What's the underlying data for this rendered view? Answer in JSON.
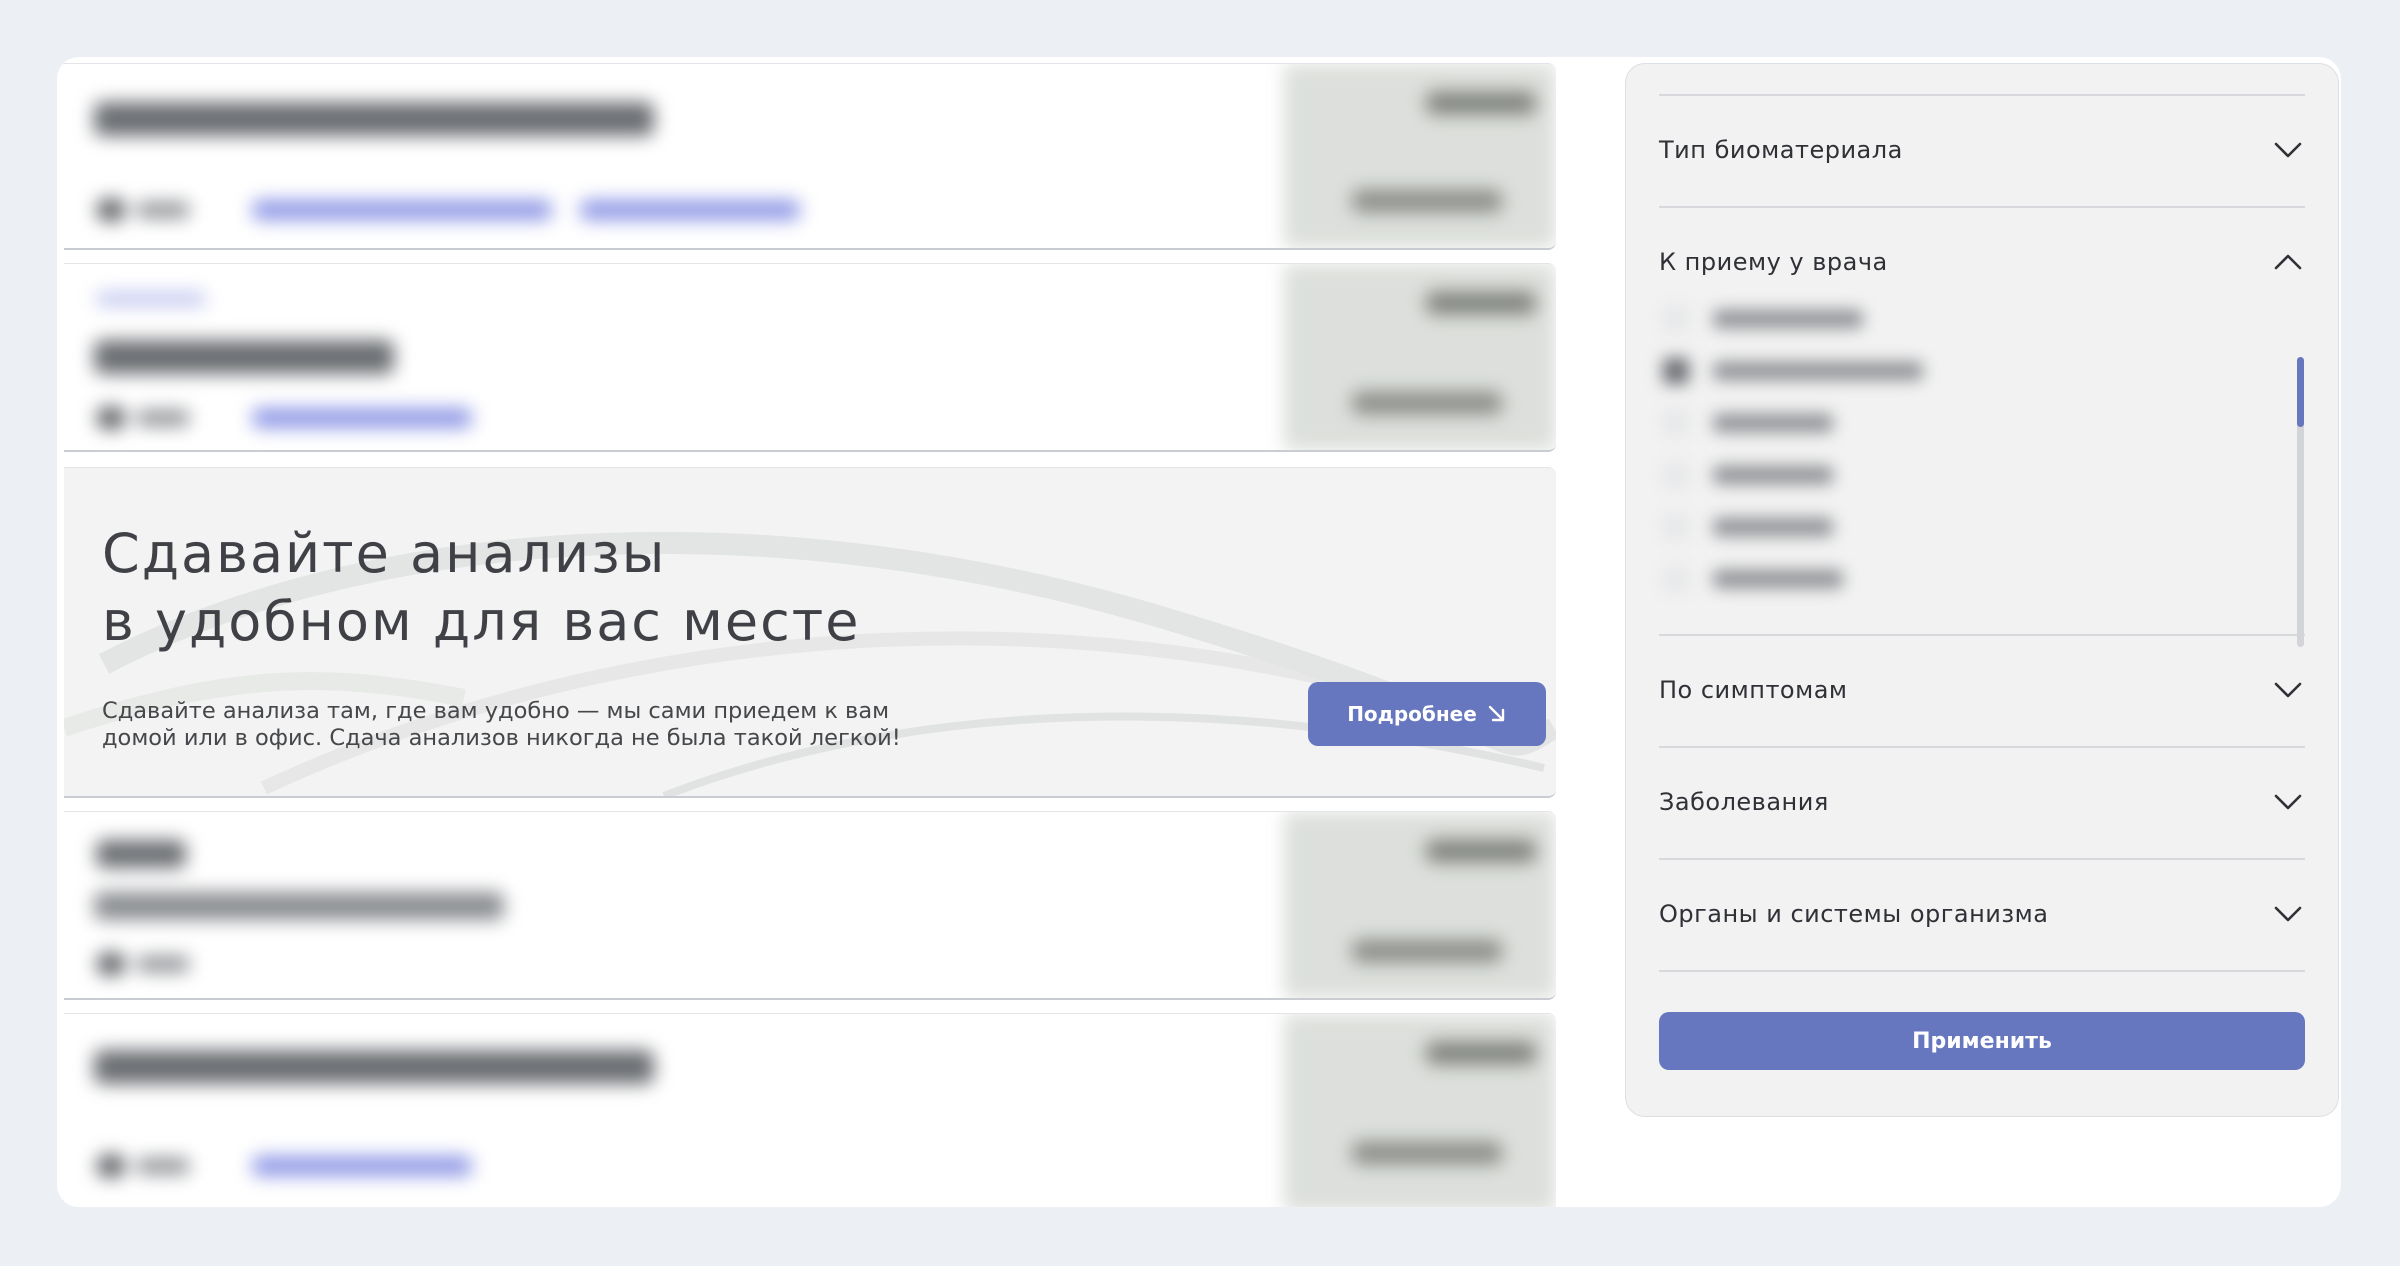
{
  "promo": {
    "title_line1": "Сдавайте анализы",
    "title_line2": "в удобном для вас месте",
    "text_line1": "Сдавайте анализа там, где вам удобно — мы сами приедем к вам",
    "text_line2": "домой или в офис. Сдача анализов никогда не была такой легкой!",
    "button_label": "Подробнее",
    "button_icon": "arrow-down-right-icon"
  },
  "filters": {
    "sections": [
      {
        "label": "Тип биоматериала",
        "expanded": false
      },
      {
        "label": "К приему у врача",
        "expanded": true
      },
      {
        "label": "По симптомам",
        "expanded": false
      },
      {
        "label": "Заболевания",
        "expanded": false
      },
      {
        "label": "Органы и системы организма",
        "expanded": false
      }
    ],
    "apply_label": "Применить"
  },
  "colors": {
    "accent": "#6676bf",
    "panel_bg": "#f2f2f2",
    "page_bg": "#eceff4"
  }
}
